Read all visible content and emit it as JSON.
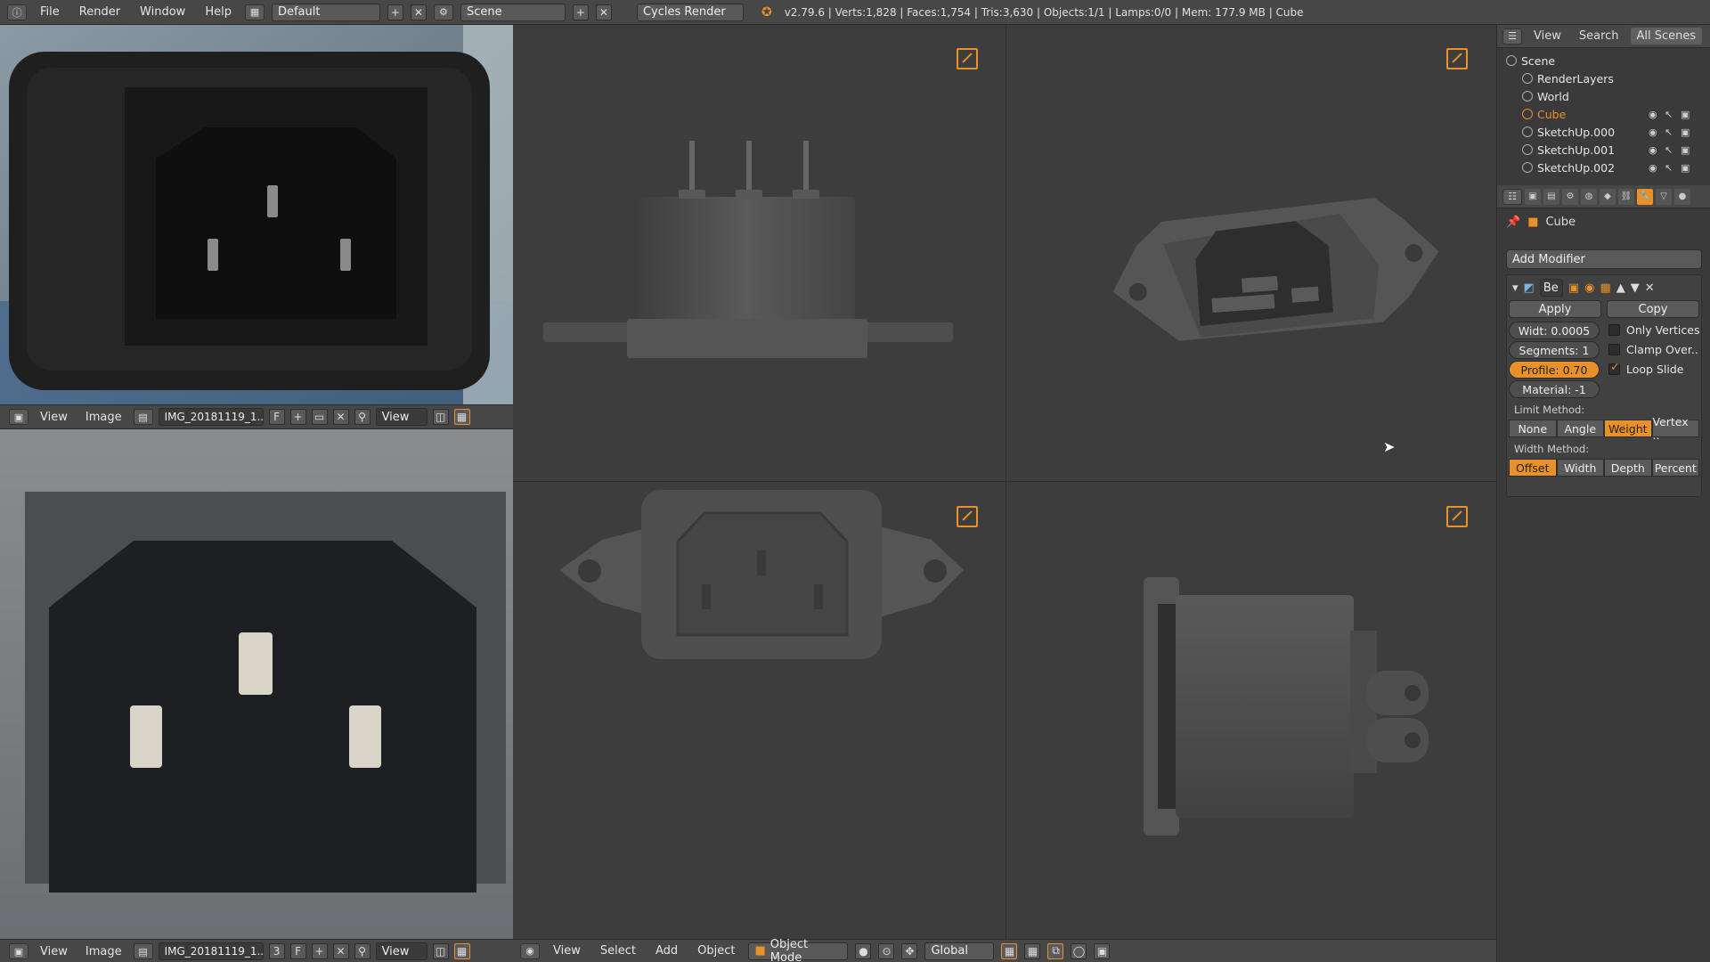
{
  "topbar": {
    "menus": [
      "File",
      "Render",
      "Window",
      "Help"
    ],
    "screen_layout": "Default",
    "scene": "Scene",
    "engine": "Cycles Render",
    "stats": "v2.79.6 | Verts:1,828 | Faces:1,754 | Tris:3,630 | Objects:1/1 | Lamps:0/0 | Mem: 177.9 MB | Cube"
  },
  "image_editor_top": {
    "menu_view": "View",
    "menu_image": "Image",
    "image_name": "IMG_20181119_1..",
    "flag": "F",
    "view_label": "View"
  },
  "image_editor_bottom": {
    "menu_view": "View",
    "menu_image": "Image",
    "image_name": "IMG_20181119_1..",
    "users": "3",
    "flag": "F",
    "view_label": "View"
  },
  "viewport_header": {
    "menus": [
      "View",
      "Select",
      "Add",
      "Object"
    ],
    "mode": "Object Mode",
    "orientation": "Global"
  },
  "outliner": {
    "tabs": [
      "View",
      "Search",
      "All Scenes"
    ],
    "rows": [
      {
        "label": "Scene",
        "icon": "scene-icon"
      },
      {
        "label": "RenderLayers",
        "icon": "renderlayers-icon"
      },
      {
        "label": "World",
        "icon": "world-icon"
      },
      {
        "label": "Cube",
        "icon": "mesh-icon",
        "selected": true
      },
      {
        "label": "SketchUp.000",
        "icon": "mesh-icon"
      },
      {
        "label": "SketchUp.001",
        "icon": "mesh-icon"
      },
      {
        "label": "SketchUp.002",
        "icon": "mesh-icon"
      }
    ]
  },
  "properties": {
    "object_name": "Cube",
    "add_modifier": "Add Modifier",
    "modifier_short": "Be",
    "apply": "Apply",
    "copy": "Copy",
    "width": "Widt: 0.0005",
    "segments": "Segments: 1",
    "profile_label": "Profile:",
    "profile_value": "0.70",
    "material": "Material: -1",
    "only_vertices": "Only Vertices",
    "clamp_overlap": "Clamp Over..",
    "loop_slide": "Loop Slide",
    "limit_method_label": "Limit Method:",
    "limit_methods": [
      "None",
      "Angle",
      "Weight",
      "Vertex .."
    ],
    "width_method_label": "Width Method:",
    "width_methods": [
      "Offset",
      "Width",
      "Depth",
      "Percent"
    ]
  },
  "colors": {
    "accent": "#e8902a",
    "panel": "#3a3a3a",
    "header": "#474747",
    "viewport": "#3d3d3d",
    "model": "#4a4a4a"
  }
}
